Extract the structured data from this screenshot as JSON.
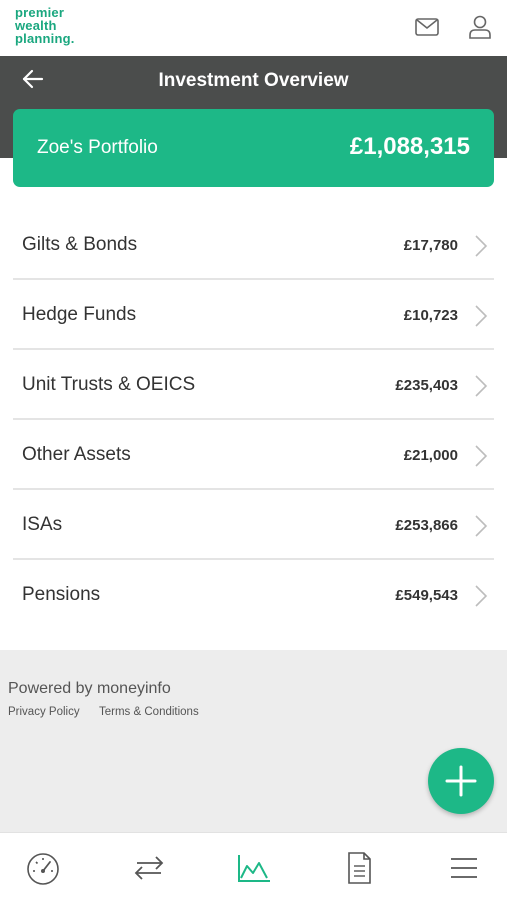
{
  "brand": {
    "logo_lines": [
      "premier",
      "wealth",
      "planning."
    ]
  },
  "header": {
    "title": "Investment Overview"
  },
  "portfolio": {
    "name": "Zoe's Portfolio",
    "total": "£1,088,315"
  },
  "assets": [
    {
      "label": "Gilts & Bonds",
      "value": "£17,780"
    },
    {
      "label": "Hedge Funds",
      "value": "£10,723"
    },
    {
      "label": "Unit Trusts & OEICS",
      "value": "£235,403"
    },
    {
      "label": "Other Assets",
      "value": "£21,000"
    },
    {
      "label": "ISAs",
      "value": "£253,866"
    },
    {
      "label": "Pensions",
      "value": "£549,543"
    }
  ],
  "footer": {
    "powered_by": "Powered by moneyinfo",
    "privacy": "Privacy Policy",
    "terms": "Terms & Conditions"
  },
  "colors": {
    "accent": "#1db887",
    "header_bg": "#4b4d4c",
    "logo": "#1aa77f"
  },
  "nav": {
    "items": [
      "gauge-icon",
      "transfer-arrows-icon",
      "line-chart-icon",
      "document-icon",
      "hamburger-menu-icon"
    ],
    "active": "line-chart-icon"
  }
}
